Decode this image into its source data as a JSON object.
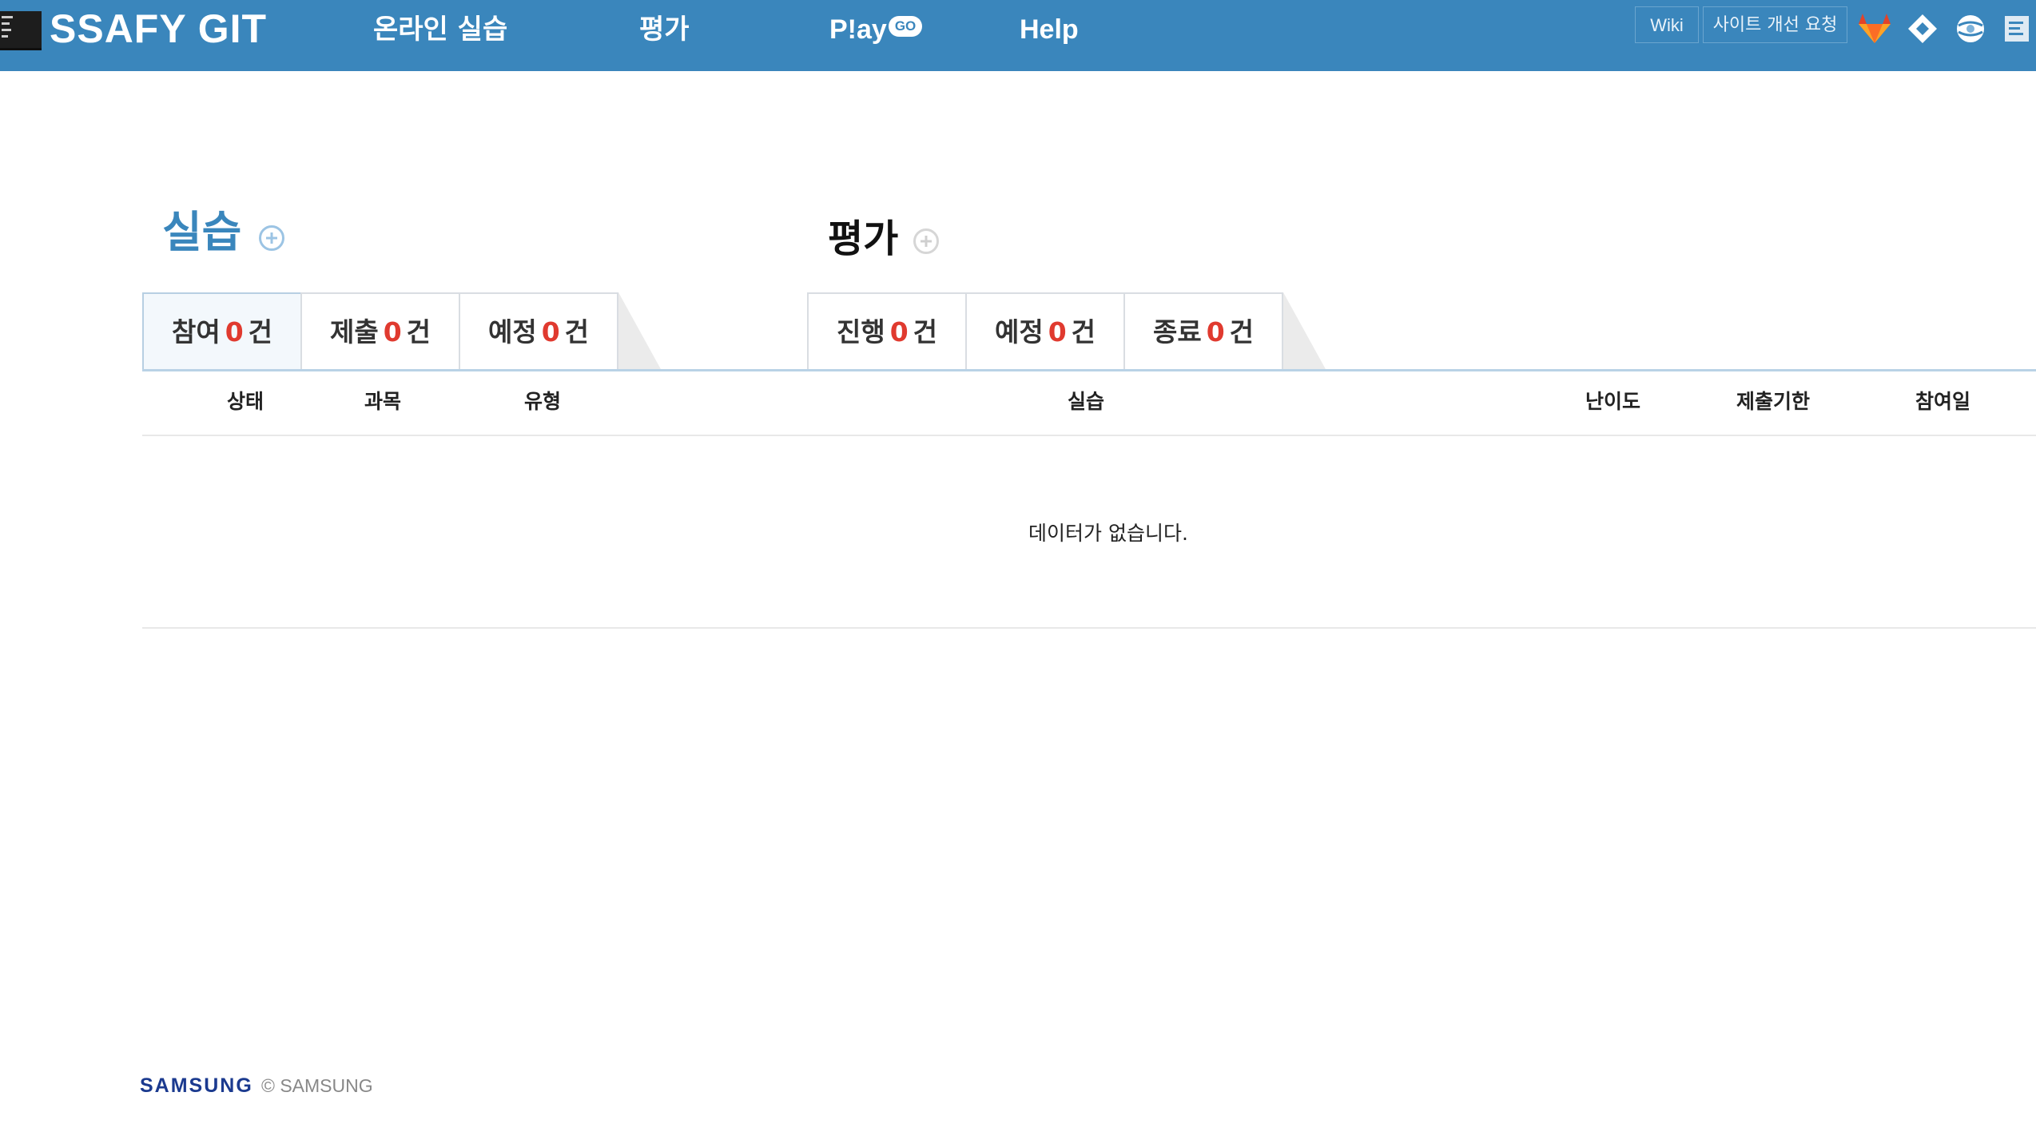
{
  "header": {
    "brand": "SSAFY GIT",
    "nav": {
      "online_practice": "온라인 실습",
      "evaluation": "평가",
      "play": "P!ay",
      "play_badge": "GO",
      "help": "Help"
    },
    "buttons": {
      "wiki": "Wiki",
      "site_request": "사이트 개선 요청"
    },
    "icons": [
      "gitlab-icon",
      "diamond-icon",
      "globe-icon",
      "document-icon"
    ]
  },
  "practice": {
    "title": "실습",
    "tabs": [
      {
        "label": "참여",
        "count": "0",
        "unit": "건",
        "active": true
      },
      {
        "label": "제출",
        "count": "0",
        "unit": "건",
        "active": false
      },
      {
        "label": "예정",
        "count": "0",
        "unit": "건",
        "active": false
      }
    ]
  },
  "evaluation": {
    "title": "평가",
    "tabs": [
      {
        "label": "진행",
        "count": "0",
        "unit": "건"
      },
      {
        "label": "예정",
        "count": "0",
        "unit": "건"
      },
      {
        "label": "종료",
        "count": "0",
        "unit": "건"
      }
    ]
  },
  "table": {
    "columns": {
      "status": "상태",
      "subject": "과목",
      "type": "유형",
      "practice": "실습",
      "difficulty": "난이도",
      "deadline": "제출기한",
      "joined": "참여일"
    },
    "empty_message": "데이터가 없습니다."
  },
  "footer": {
    "logo": "SAMSUNG",
    "copyright": "© SAMSUNG"
  },
  "colors": {
    "header_bg": "#3a86bc",
    "count_red": "#e03a2f",
    "practice_title": "#3a86bc",
    "samsung_blue": "#1b3a8f"
  }
}
